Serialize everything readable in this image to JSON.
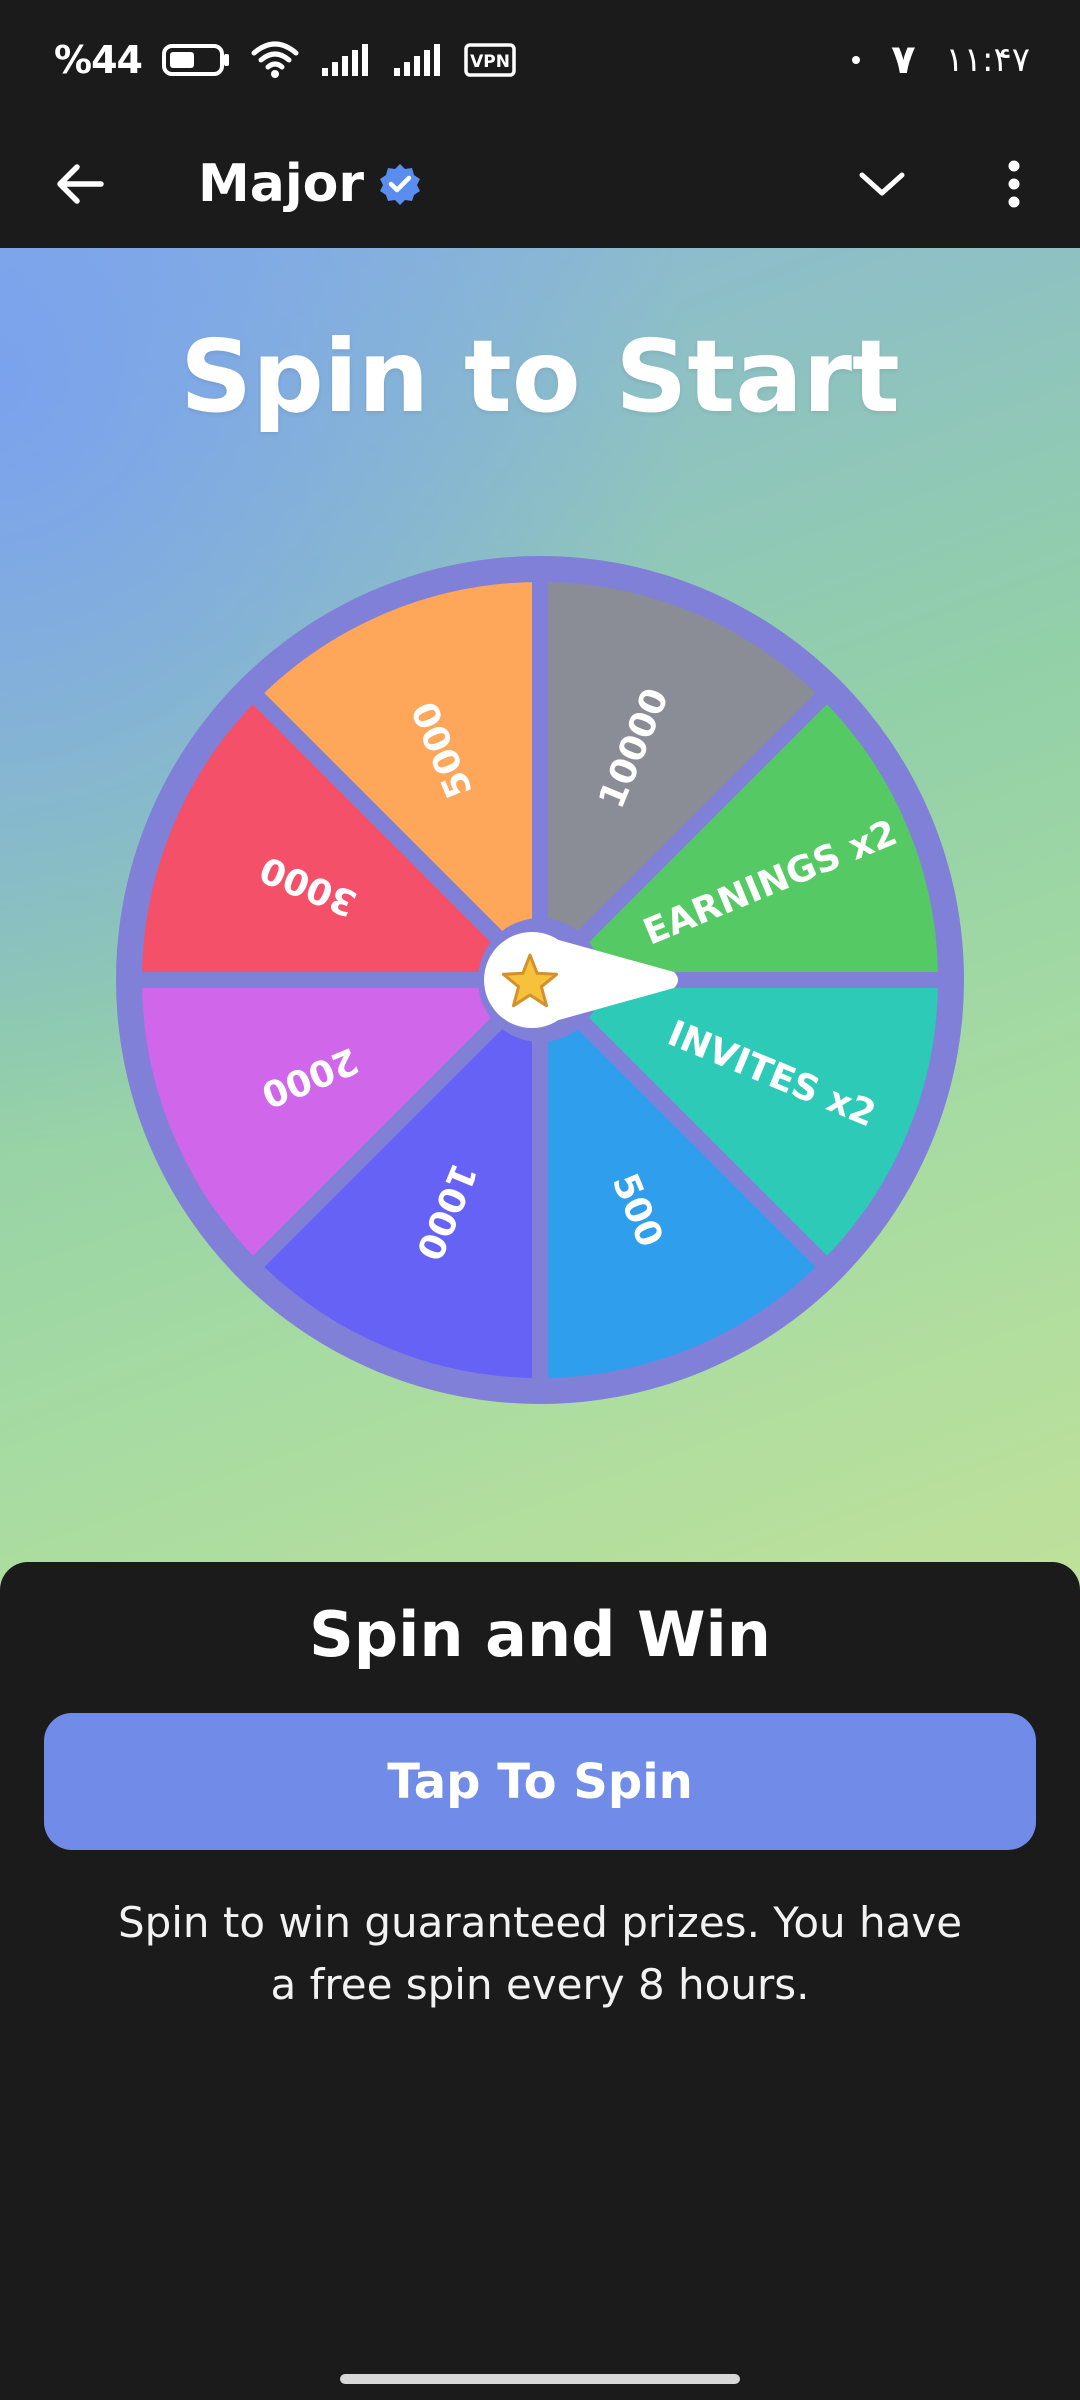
{
  "status_bar": {
    "battery_text": "%44",
    "time_text": "۱۱:۴۷",
    "notification_digit": "۷",
    "vpn_label": "VPN"
  },
  "header": {
    "title": "Major",
    "icons": {
      "back": "arrow-left-icon",
      "verified": "verified-badge-icon",
      "collapse": "chevron-down-icon",
      "menu": "more-vertical-icon"
    }
  },
  "game": {
    "title": "Spin to Start",
    "center_icon": "star-icon",
    "segments": [
      {
        "label": "10000",
        "color": "#8a8d96"
      },
      {
        "label": "EARNINGS x2",
        "color": "#55c964"
      },
      {
        "label": "INVITES x2",
        "color": "#2dcab8"
      },
      {
        "label": "500",
        "color": "#2f9eed"
      },
      {
        "label": "1000",
        "color": "#6562f5"
      },
      {
        "label": "2000",
        "color": "#d066ea"
      },
      {
        "label": "3000",
        "color": "#f5506a"
      },
      {
        "label": "5000",
        "color": "#fea659"
      }
    ],
    "rim_color": "#8080d8"
  },
  "sheet": {
    "title": "Spin and Win",
    "button_label": "Tap To Spin",
    "description": "Spin to win guaranteed prizes. You have a free spin every 8 hours."
  }
}
